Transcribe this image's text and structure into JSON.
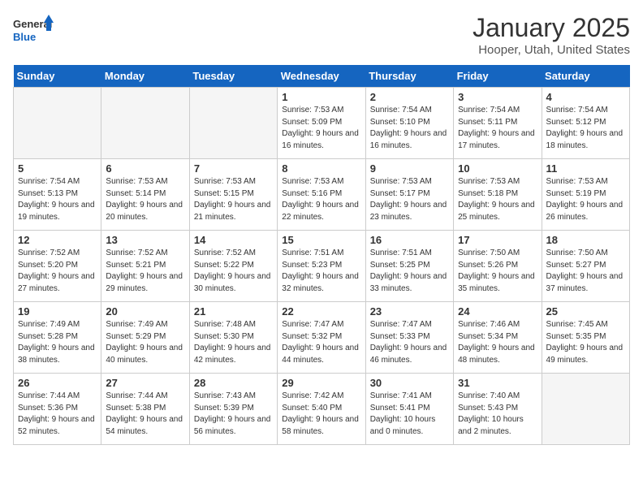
{
  "logo": {
    "text_general": "General",
    "text_blue": "Blue"
  },
  "title": "January 2025",
  "subtitle": "Hooper, Utah, United States",
  "days_of_week": [
    "Sunday",
    "Monday",
    "Tuesday",
    "Wednesday",
    "Thursday",
    "Friday",
    "Saturday"
  ],
  "weeks": [
    [
      {
        "day": "",
        "empty": true
      },
      {
        "day": "",
        "empty": true
      },
      {
        "day": "",
        "empty": true
      },
      {
        "day": "1",
        "sunrise": "7:53 AM",
        "sunset": "5:09 PM",
        "daylight": "9 hours and 16 minutes."
      },
      {
        "day": "2",
        "sunrise": "7:54 AM",
        "sunset": "5:10 PM",
        "daylight": "9 hours and 16 minutes."
      },
      {
        "day": "3",
        "sunrise": "7:54 AM",
        "sunset": "5:11 PM",
        "daylight": "9 hours and 17 minutes."
      },
      {
        "day": "4",
        "sunrise": "7:54 AM",
        "sunset": "5:12 PM",
        "daylight": "9 hours and 18 minutes."
      }
    ],
    [
      {
        "day": "5",
        "sunrise": "7:54 AM",
        "sunset": "5:13 PM",
        "daylight": "9 hours and 19 minutes."
      },
      {
        "day": "6",
        "sunrise": "7:53 AM",
        "sunset": "5:14 PM",
        "daylight": "9 hours and 20 minutes."
      },
      {
        "day": "7",
        "sunrise": "7:53 AM",
        "sunset": "5:15 PM",
        "daylight": "9 hours and 21 minutes."
      },
      {
        "day": "8",
        "sunrise": "7:53 AM",
        "sunset": "5:16 PM",
        "daylight": "9 hours and 22 minutes."
      },
      {
        "day": "9",
        "sunrise": "7:53 AM",
        "sunset": "5:17 PM",
        "daylight": "9 hours and 23 minutes."
      },
      {
        "day": "10",
        "sunrise": "7:53 AM",
        "sunset": "5:18 PM",
        "daylight": "9 hours and 25 minutes."
      },
      {
        "day": "11",
        "sunrise": "7:53 AM",
        "sunset": "5:19 PM",
        "daylight": "9 hours and 26 minutes."
      }
    ],
    [
      {
        "day": "12",
        "sunrise": "7:52 AM",
        "sunset": "5:20 PM",
        "daylight": "9 hours and 27 minutes."
      },
      {
        "day": "13",
        "sunrise": "7:52 AM",
        "sunset": "5:21 PM",
        "daylight": "9 hours and 29 minutes."
      },
      {
        "day": "14",
        "sunrise": "7:52 AM",
        "sunset": "5:22 PM",
        "daylight": "9 hours and 30 minutes."
      },
      {
        "day": "15",
        "sunrise": "7:51 AM",
        "sunset": "5:23 PM",
        "daylight": "9 hours and 32 minutes."
      },
      {
        "day": "16",
        "sunrise": "7:51 AM",
        "sunset": "5:25 PM",
        "daylight": "9 hours and 33 minutes."
      },
      {
        "day": "17",
        "sunrise": "7:50 AM",
        "sunset": "5:26 PM",
        "daylight": "9 hours and 35 minutes."
      },
      {
        "day": "18",
        "sunrise": "7:50 AM",
        "sunset": "5:27 PM",
        "daylight": "9 hours and 37 minutes."
      }
    ],
    [
      {
        "day": "19",
        "sunrise": "7:49 AM",
        "sunset": "5:28 PM",
        "daylight": "9 hours and 38 minutes."
      },
      {
        "day": "20",
        "sunrise": "7:49 AM",
        "sunset": "5:29 PM",
        "daylight": "9 hours and 40 minutes."
      },
      {
        "day": "21",
        "sunrise": "7:48 AM",
        "sunset": "5:30 PM",
        "daylight": "9 hours and 42 minutes."
      },
      {
        "day": "22",
        "sunrise": "7:47 AM",
        "sunset": "5:32 PM",
        "daylight": "9 hours and 44 minutes."
      },
      {
        "day": "23",
        "sunrise": "7:47 AM",
        "sunset": "5:33 PM",
        "daylight": "9 hours and 46 minutes."
      },
      {
        "day": "24",
        "sunrise": "7:46 AM",
        "sunset": "5:34 PM",
        "daylight": "9 hours and 48 minutes."
      },
      {
        "day": "25",
        "sunrise": "7:45 AM",
        "sunset": "5:35 PM",
        "daylight": "9 hours and 49 minutes."
      }
    ],
    [
      {
        "day": "26",
        "sunrise": "7:44 AM",
        "sunset": "5:36 PM",
        "daylight": "9 hours and 52 minutes."
      },
      {
        "day": "27",
        "sunrise": "7:44 AM",
        "sunset": "5:38 PM",
        "daylight": "9 hours and 54 minutes."
      },
      {
        "day": "28",
        "sunrise": "7:43 AM",
        "sunset": "5:39 PM",
        "daylight": "9 hours and 56 minutes."
      },
      {
        "day": "29",
        "sunrise": "7:42 AM",
        "sunset": "5:40 PM",
        "daylight": "9 hours and 58 minutes."
      },
      {
        "day": "30",
        "sunrise": "7:41 AM",
        "sunset": "5:41 PM",
        "daylight": "10 hours and 0 minutes."
      },
      {
        "day": "31",
        "sunrise": "7:40 AM",
        "sunset": "5:43 PM",
        "daylight": "10 hours and 2 minutes."
      },
      {
        "day": "",
        "empty": true
      }
    ]
  ]
}
